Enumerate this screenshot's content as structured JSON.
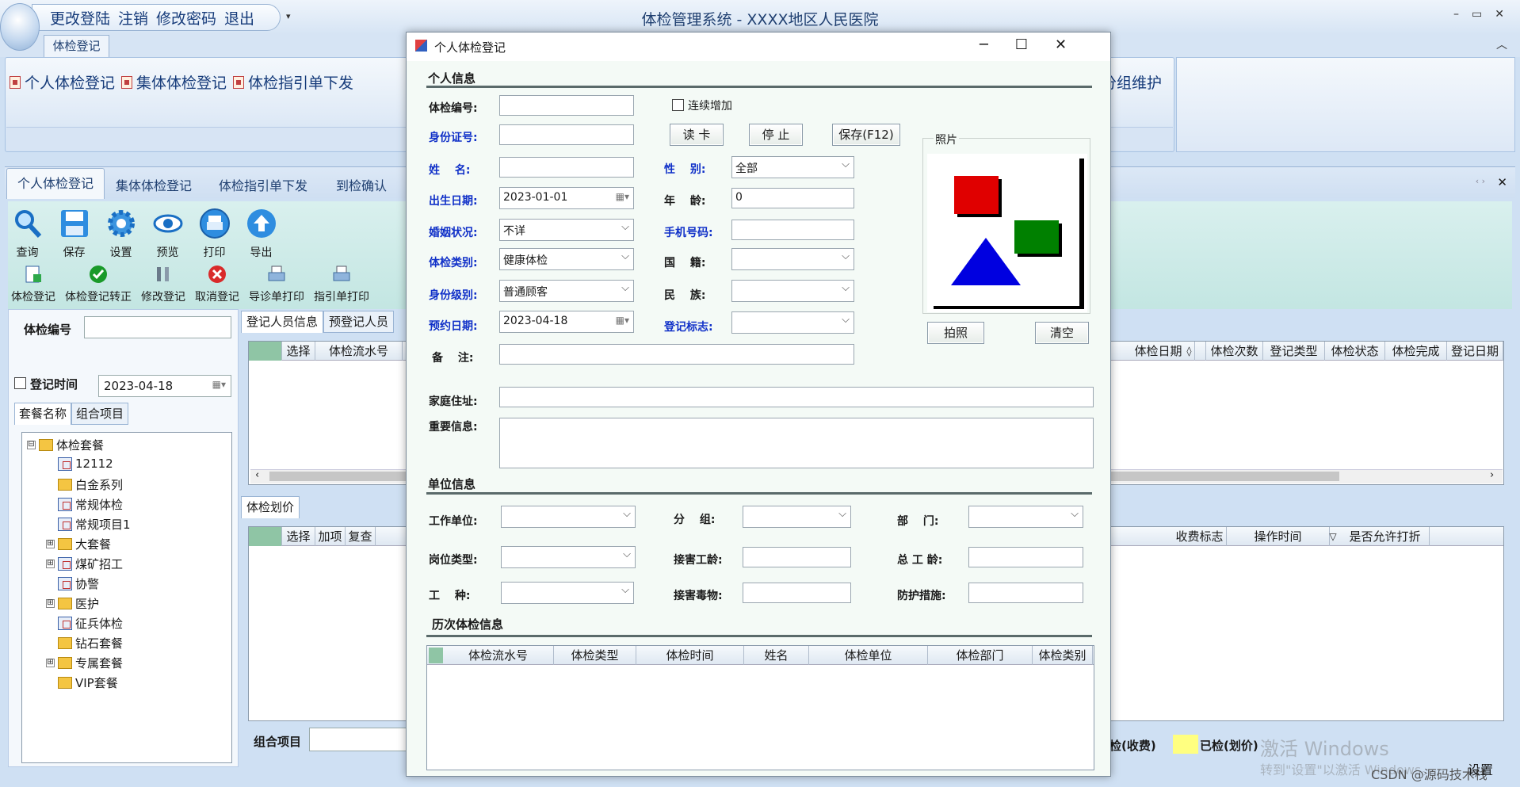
{
  "window": {
    "title": "体检管理系统  -  XXXX地区人民医院",
    "quick_menu": [
      "更改登陆",
      "注销",
      "修改密码",
      "退出"
    ],
    "caps": [
      "–",
      "▭",
      "✕"
    ]
  },
  "ribbon": {
    "tab": "体检登记",
    "buttons": [
      "个人体检登记",
      "集体体检登记",
      "体检指引单下发"
    ],
    "tail_label": "分组维护"
  },
  "doc_tabs": [
    "个人体检登记",
    "集体体检登记",
    "体检指引单下发",
    "到检确认"
  ],
  "toolbar": {
    "big": [
      {
        "label": "查询",
        "icon": "search-icon"
      },
      {
        "label": "保存",
        "icon": "save-icon"
      },
      {
        "label": "设置",
        "icon": "gear-icon"
      },
      {
        "label": "预览",
        "icon": "eye-icon"
      },
      {
        "label": "打印",
        "icon": "print-icon"
      },
      {
        "label": "导出",
        "icon": "export-icon"
      }
    ],
    "small": [
      {
        "label": "体检登记",
        "icon": "register-icon"
      },
      {
        "label": "体检登记转正",
        "icon": "check-icon"
      },
      {
        "label": "修改登记",
        "icon": "tools-icon"
      },
      {
        "label": "取消登记",
        "icon": "cancel-icon"
      },
      {
        "label": "导诊单打印",
        "icon": "printer-icon"
      },
      {
        "label": "指引单打印",
        "icon": "printer-icon"
      }
    ]
  },
  "left_pane": {
    "exam_no_label": "体检编号",
    "reg_time_label": "登记时间",
    "reg_date": "2023-04-18",
    "tabs": [
      "套餐名称",
      "组合项目"
    ],
    "tree": [
      {
        "label": "体检套餐",
        "level": 0,
        "toggle": "⊟",
        "kind": "root"
      },
      {
        "label": "12112",
        "level": 1,
        "toggle": "",
        "kind": "item"
      },
      {
        "label": "白金系列",
        "level": 1,
        "toggle": "",
        "kind": "folder"
      },
      {
        "label": "常规体检",
        "level": 1,
        "toggle": "",
        "kind": "item"
      },
      {
        "label": "常规项目1",
        "level": 1,
        "toggle": "",
        "kind": "item"
      },
      {
        "label": "大套餐",
        "level": 1,
        "toggle": "⊞",
        "kind": "folder"
      },
      {
        "label": "煤矿招工",
        "level": 1,
        "toggle": "⊞",
        "kind": "item"
      },
      {
        "label": "协警",
        "level": 1,
        "toggle": "",
        "kind": "item"
      },
      {
        "label": "医护",
        "level": 1,
        "toggle": "⊞",
        "kind": "folder"
      },
      {
        "label": "征兵体检",
        "level": 1,
        "toggle": "",
        "kind": "item"
      },
      {
        "label": "钻石套餐",
        "level": 1,
        "toggle": "",
        "kind": "folder"
      },
      {
        "label": "专属套餐",
        "level": 1,
        "toggle": "⊞",
        "kind": "folder"
      },
      {
        "label": "VIP套餐",
        "level": 1,
        "toggle": "",
        "kind": "folder"
      }
    ]
  },
  "mid": {
    "tabs": [
      "登记人员信息",
      "预登记人员"
    ],
    "grid1_cols_left": [
      "选择",
      "体检流水号"
    ],
    "grid1_cols_right": [
      "体检日期",
      "◊",
      "体检次数",
      "登记类型",
      "体检状态",
      "体检完成",
      "登记日期"
    ],
    "tab2": "体检划价",
    "grid2_cols_left": [
      "选择",
      "加项",
      "复查"
    ],
    "grid2_cols_right": [
      "收费标志",
      "操作时间",
      "▽",
      "是否允许打折"
    ],
    "combo_label": "组合项目",
    "legend_prefix": "检(收费)",
    "legend_label": "已检(划价)",
    "settings": "设置"
  },
  "watermark": {
    "activate": "激活 Windows",
    "activate_sub": "转到\"设置\"以激活 Windows。",
    "csdn": "CSDN @源码技术栈"
  },
  "dialog": {
    "title": "个人体检登记",
    "sec_personal": "个人信息",
    "labels": {
      "exam_no": "体检编号:",
      "id_no": "身份证号:",
      "name": "姓　 名:",
      "gender": "性　 别:",
      "birth": "出生日期:",
      "age": "年　 龄:",
      "marital": "婚姻状况:",
      "phone": "手机号码:",
      "exam_type": "体检类别:",
      "nation": "国　 籍:",
      "id_level": "身份级别:",
      "ethnic": "民　 族:",
      "appt": "预约日期:",
      "reg_flag": "登记标志:",
      "remark": "备　 注:",
      "address": "家庭住址:",
      "important": "重要信息:"
    },
    "continuous_add": "连续增加",
    "btn_read": "读 卡",
    "btn_stop": "停 止",
    "btn_save": "保存(F12)",
    "photo_label": "照片",
    "btn_photo": "拍照",
    "btn_clear": "清空",
    "values": {
      "gender": "全部",
      "birth": "2023-01-01",
      "age": "0",
      "marital": "不详",
      "exam_type": "健康体检",
      "id_level": "普通顾客",
      "appt": "2023-04-18"
    },
    "sec_unit": "单位信息",
    "unit_labels": {
      "work_unit": "工作单位:",
      "group": "分　 组:",
      "dept": "部　 门:",
      "post": "岗位类型:",
      "exposure_years": "接害工龄:",
      "total_years": "总 工 龄:",
      "job": "工　 种:",
      "toxin": "接害毒物:",
      "protect": "防护措施:"
    },
    "sec_history": "历次体检信息",
    "history_cols": [
      "体检流水号",
      "体检类型",
      "体检时间",
      "姓名",
      "体检单位",
      "体检部门",
      "体检类别"
    ]
  }
}
